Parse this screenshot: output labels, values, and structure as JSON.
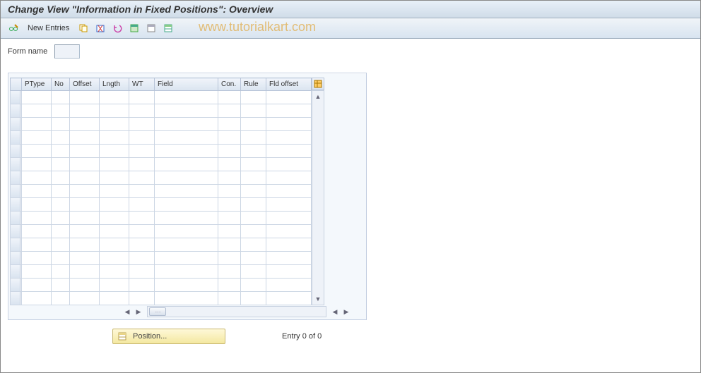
{
  "title": "Change View \"Information in Fixed Positions\": Overview",
  "toolbar": {
    "new_entries_label": "New Entries"
  },
  "watermark": "www.tutorialkart.com",
  "form": {
    "form_name_label": "Form name",
    "form_name_value": ""
  },
  "table": {
    "columns": {
      "ptype": "PType",
      "no": "No",
      "offset": "Offset",
      "lngth": "Lngth",
      "wt": "WT",
      "field": "Field",
      "con": "Con.",
      "rule": "Rule",
      "fldoffset": "Fld offset"
    },
    "row_count": 16
  },
  "footer": {
    "position_label": "Position...",
    "entry_status": "Entry 0 of 0"
  }
}
